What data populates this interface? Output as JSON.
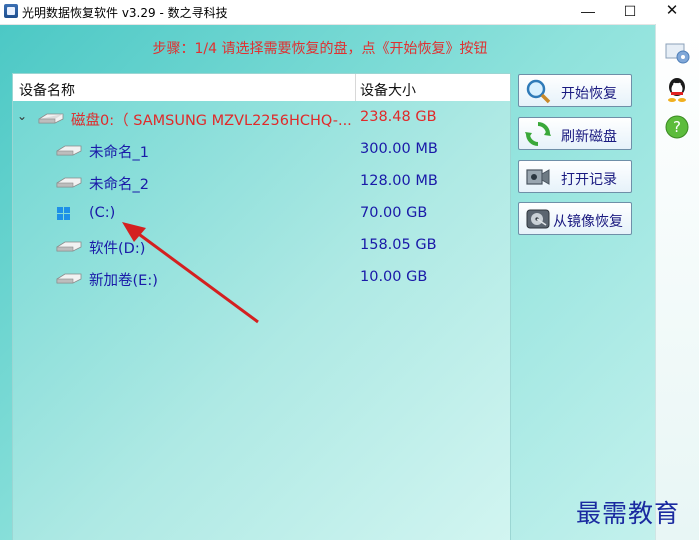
{
  "window": {
    "title": "光明数据恢复软件 v3.29 - 数之寻科技",
    "minimize_glyph": "—",
    "maximize_glyph": "☐",
    "close_glyph": "✕"
  },
  "instruction": "步骤：1/4 请选择需要恢复的盘，点《开始恢复》按钮",
  "device_list": {
    "columns": {
      "name": "设备名称",
      "size": "设备大小"
    },
    "disk": {
      "name": "磁盘0:（ SAMSUNG MZVL2256HCHQ-...",
      "size": "238.48 GB",
      "expand_glyph": "⌄"
    },
    "partitions": [
      {
        "name": "未命名_1",
        "size": "300.00 MB",
        "icon": "drive-icon"
      },
      {
        "name": "未命名_2",
        "size": "128.00 MB",
        "icon": "drive-icon"
      },
      {
        "name": "(C:)",
        "size": "70.00 GB",
        "icon": "windows-logo-icon"
      },
      {
        "name": "软件(D:)",
        "size": "158.05 GB",
        "icon": "drive-icon"
      },
      {
        "name": "新加卷(E:)",
        "size": "10.00 GB",
        "icon": "drive-icon"
      }
    ]
  },
  "actions": {
    "start_recovery": "开始恢复",
    "refresh_disk": "刷新磁盘",
    "open_log": "打开记录",
    "restore_from_image": "从镜像恢复"
  },
  "sidebar": {
    "icons": [
      "settings-icon",
      "qq-icon",
      "help-icon"
    ]
  },
  "watermark": "最需教育",
  "colors": {
    "disk_text": "#e02a2a",
    "partition_text": "#1a1aa8",
    "instruction_text": "#e03030",
    "annotation_arrow": "#d42020"
  }
}
